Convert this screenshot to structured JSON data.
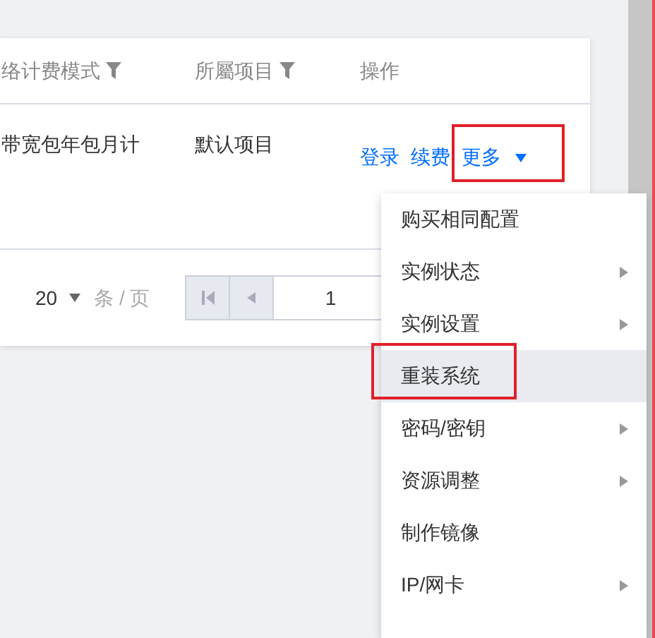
{
  "table": {
    "columns": [
      {
        "label": "络计费模式",
        "filter": true
      },
      {
        "label": "所屬项目",
        "filter": true
      },
      {
        "label": "操作",
        "filter": false
      }
    ],
    "rows": [
      {
        "billing": "带宽包年包月计",
        "project": "默认项目",
        "actions": [
          "登录",
          "续费"
        ],
        "more": "更多"
      }
    ]
  },
  "pagination": {
    "page_size": "20",
    "unit": "条 / 页",
    "page": "1"
  },
  "menu": {
    "items": [
      {
        "label": "购买相同配置",
        "submenu": false,
        "selected": false
      },
      {
        "label": "实例状态",
        "submenu": true,
        "selected": false
      },
      {
        "label": "实例设置",
        "submenu": true,
        "selected": false
      },
      {
        "label": "重装系统",
        "submenu": false,
        "selected": true
      },
      {
        "label": "密码/密钥",
        "submenu": true,
        "selected": false
      },
      {
        "label": "资源调整",
        "submenu": true,
        "selected": false
      },
      {
        "label": "制作镜像",
        "submenu": false,
        "selected": false
      },
      {
        "label": "IP/网卡",
        "submenu": true,
        "selected": false
      }
    ]
  }
}
